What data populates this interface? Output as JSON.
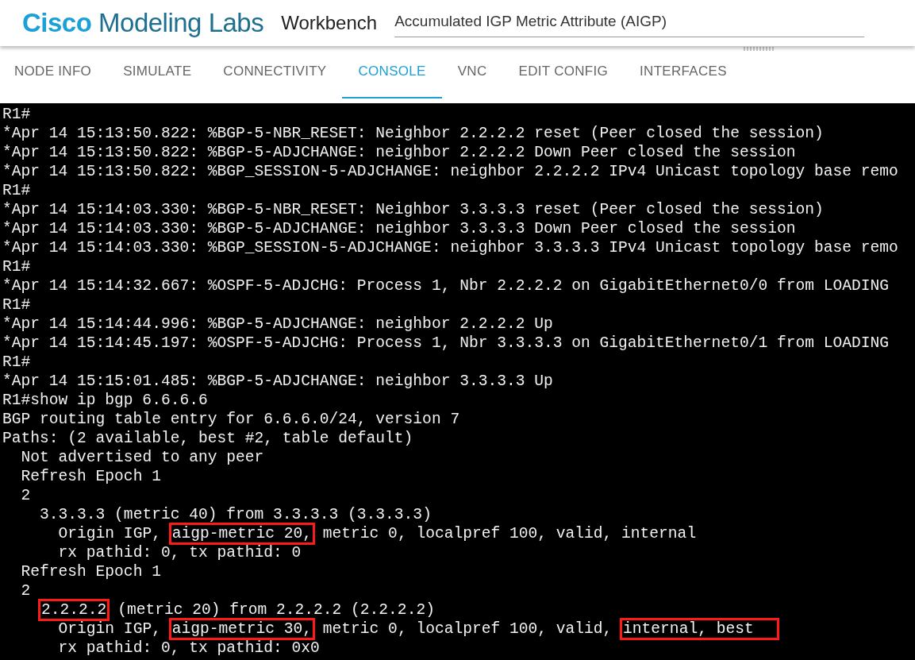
{
  "header": {
    "brand_bold": "Cisco",
    "brand_rest": "Modeling Labs",
    "section": "Workbench",
    "title_field": {
      "value": "Accumulated IGP Metric Attribute (AIGP)"
    }
  },
  "tabs": [
    {
      "label": "NODE INFO",
      "selected": false
    },
    {
      "label": "SIMULATE",
      "selected": false
    },
    {
      "label": "CONNECTIVITY",
      "selected": false
    },
    {
      "label": "CONSOLE",
      "selected": true
    },
    {
      "label": "VNC",
      "selected": false
    },
    {
      "label": "EDIT CONFIG",
      "selected": false
    },
    {
      "label": "INTERFACES",
      "selected": false
    }
  ],
  "console": {
    "lines": [
      [
        {
          "text": "R1#",
          "highlighted": false
        }
      ],
      [
        {
          "text": "*Apr 14 15:13:50.822: %BGP-5-NBR_RESET: Neighbor 2.2.2.2 reset (Peer closed the session)",
          "highlighted": false
        }
      ],
      [
        {
          "text": "*Apr 14 15:13:50.822: %BGP-5-ADJCHANGE: neighbor 2.2.2.2 Down Peer closed the session",
          "highlighted": false
        }
      ],
      [
        {
          "text": "*Apr 14 15:13:50.822: %BGP_SESSION-5-ADJCHANGE: neighbor 2.2.2.2 IPv4 Unicast topology base remo",
          "highlighted": false
        }
      ],
      [
        {
          "text": "R1#",
          "highlighted": false
        }
      ],
      [
        {
          "text": "*Apr 14 15:14:03.330: %BGP-5-NBR_RESET: Neighbor 3.3.3.3 reset (Peer closed the session)",
          "highlighted": false
        }
      ],
      [
        {
          "text": "*Apr 14 15:14:03.330: %BGP-5-ADJCHANGE: neighbor 3.3.3.3 Down Peer closed the session",
          "highlighted": false
        }
      ],
      [
        {
          "text": "*Apr 14 15:14:03.330: %BGP_SESSION-5-ADJCHANGE: neighbor 3.3.3.3 IPv4 Unicast topology base remo",
          "highlighted": false
        }
      ],
      [
        {
          "text": "R1#",
          "highlighted": false
        }
      ],
      [
        {
          "text": "*Apr 14 15:14:32.667: %OSPF-5-ADJCHG: Process 1, Nbr 2.2.2.2 on GigabitEthernet0/0 from LOADING",
          "highlighted": false
        }
      ],
      [
        {
          "text": "R1#",
          "highlighted": false
        }
      ],
      [
        {
          "text": "*Apr 14 15:14:44.996: %BGP-5-ADJCHANGE: neighbor 2.2.2.2 Up",
          "highlighted": false
        }
      ],
      [
        {
          "text": "*Apr 14 15:14:45.197: %OSPF-5-ADJCHG: Process 1, Nbr 3.3.3.3 on GigabitEthernet0/1 from LOADING",
          "highlighted": false
        }
      ],
      [
        {
          "text": "R1#",
          "highlighted": false
        }
      ],
      [
        {
          "text": "*Apr 14 15:15:01.485: %BGP-5-ADJCHANGE: neighbor 3.3.3.3 Up",
          "highlighted": false
        }
      ],
      [
        {
          "text": "R1#show ip bgp 6.6.6.6",
          "highlighted": false
        }
      ],
      [
        {
          "text": "BGP routing table entry for 6.6.6.0/24, version 7",
          "highlighted": false
        }
      ],
      [
        {
          "text": "Paths: (2 available, best #2, table default)",
          "highlighted": false
        }
      ],
      [
        {
          "text": "  Not advertised to any peer",
          "highlighted": false
        }
      ],
      [
        {
          "text": "  Refresh Epoch 1",
          "highlighted": false
        }
      ],
      [
        {
          "text": "  2",
          "highlighted": false
        }
      ],
      [
        {
          "text": "    3.3.3.3 (metric 40) from 3.3.3.3 (3.3.3.3)",
          "highlighted": false
        }
      ],
      [
        {
          "text": "      Origin IGP, ",
          "highlighted": false
        },
        {
          "text": "aigp-metric 20,",
          "highlighted": true
        },
        {
          "text": " metric 0, localpref 100, valid, internal",
          "highlighted": false
        }
      ],
      [
        {
          "text": "      rx pathid: 0, tx pathid: 0",
          "highlighted": false
        }
      ],
      [
        {
          "text": "  Refresh Epoch 1",
          "highlighted": false
        }
      ],
      [
        {
          "text": "  2",
          "highlighted": false
        }
      ],
      [
        {
          "text": "    2.2.2.2",
          "highlighted": true
        },
        {
          "text": " (metric 20) from 2.2.2.2 (2.2.2.2)",
          "highlighted": false
        }
      ],
      [
        {
          "text": "      Origin IGP, ",
          "highlighted": false
        },
        {
          "text": "aigp-metric 30,",
          "highlighted": true
        },
        {
          "text": " metric 0, localpref 100, valid, ",
          "highlighted": false
        },
        {
          "text": "internal, best",
          "highlighted": true
        }
      ],
      [
        {
          "text": "      rx pathid: 0, tx pathid: 0x0",
          "highlighted": false
        }
      ]
    ]
  }
}
